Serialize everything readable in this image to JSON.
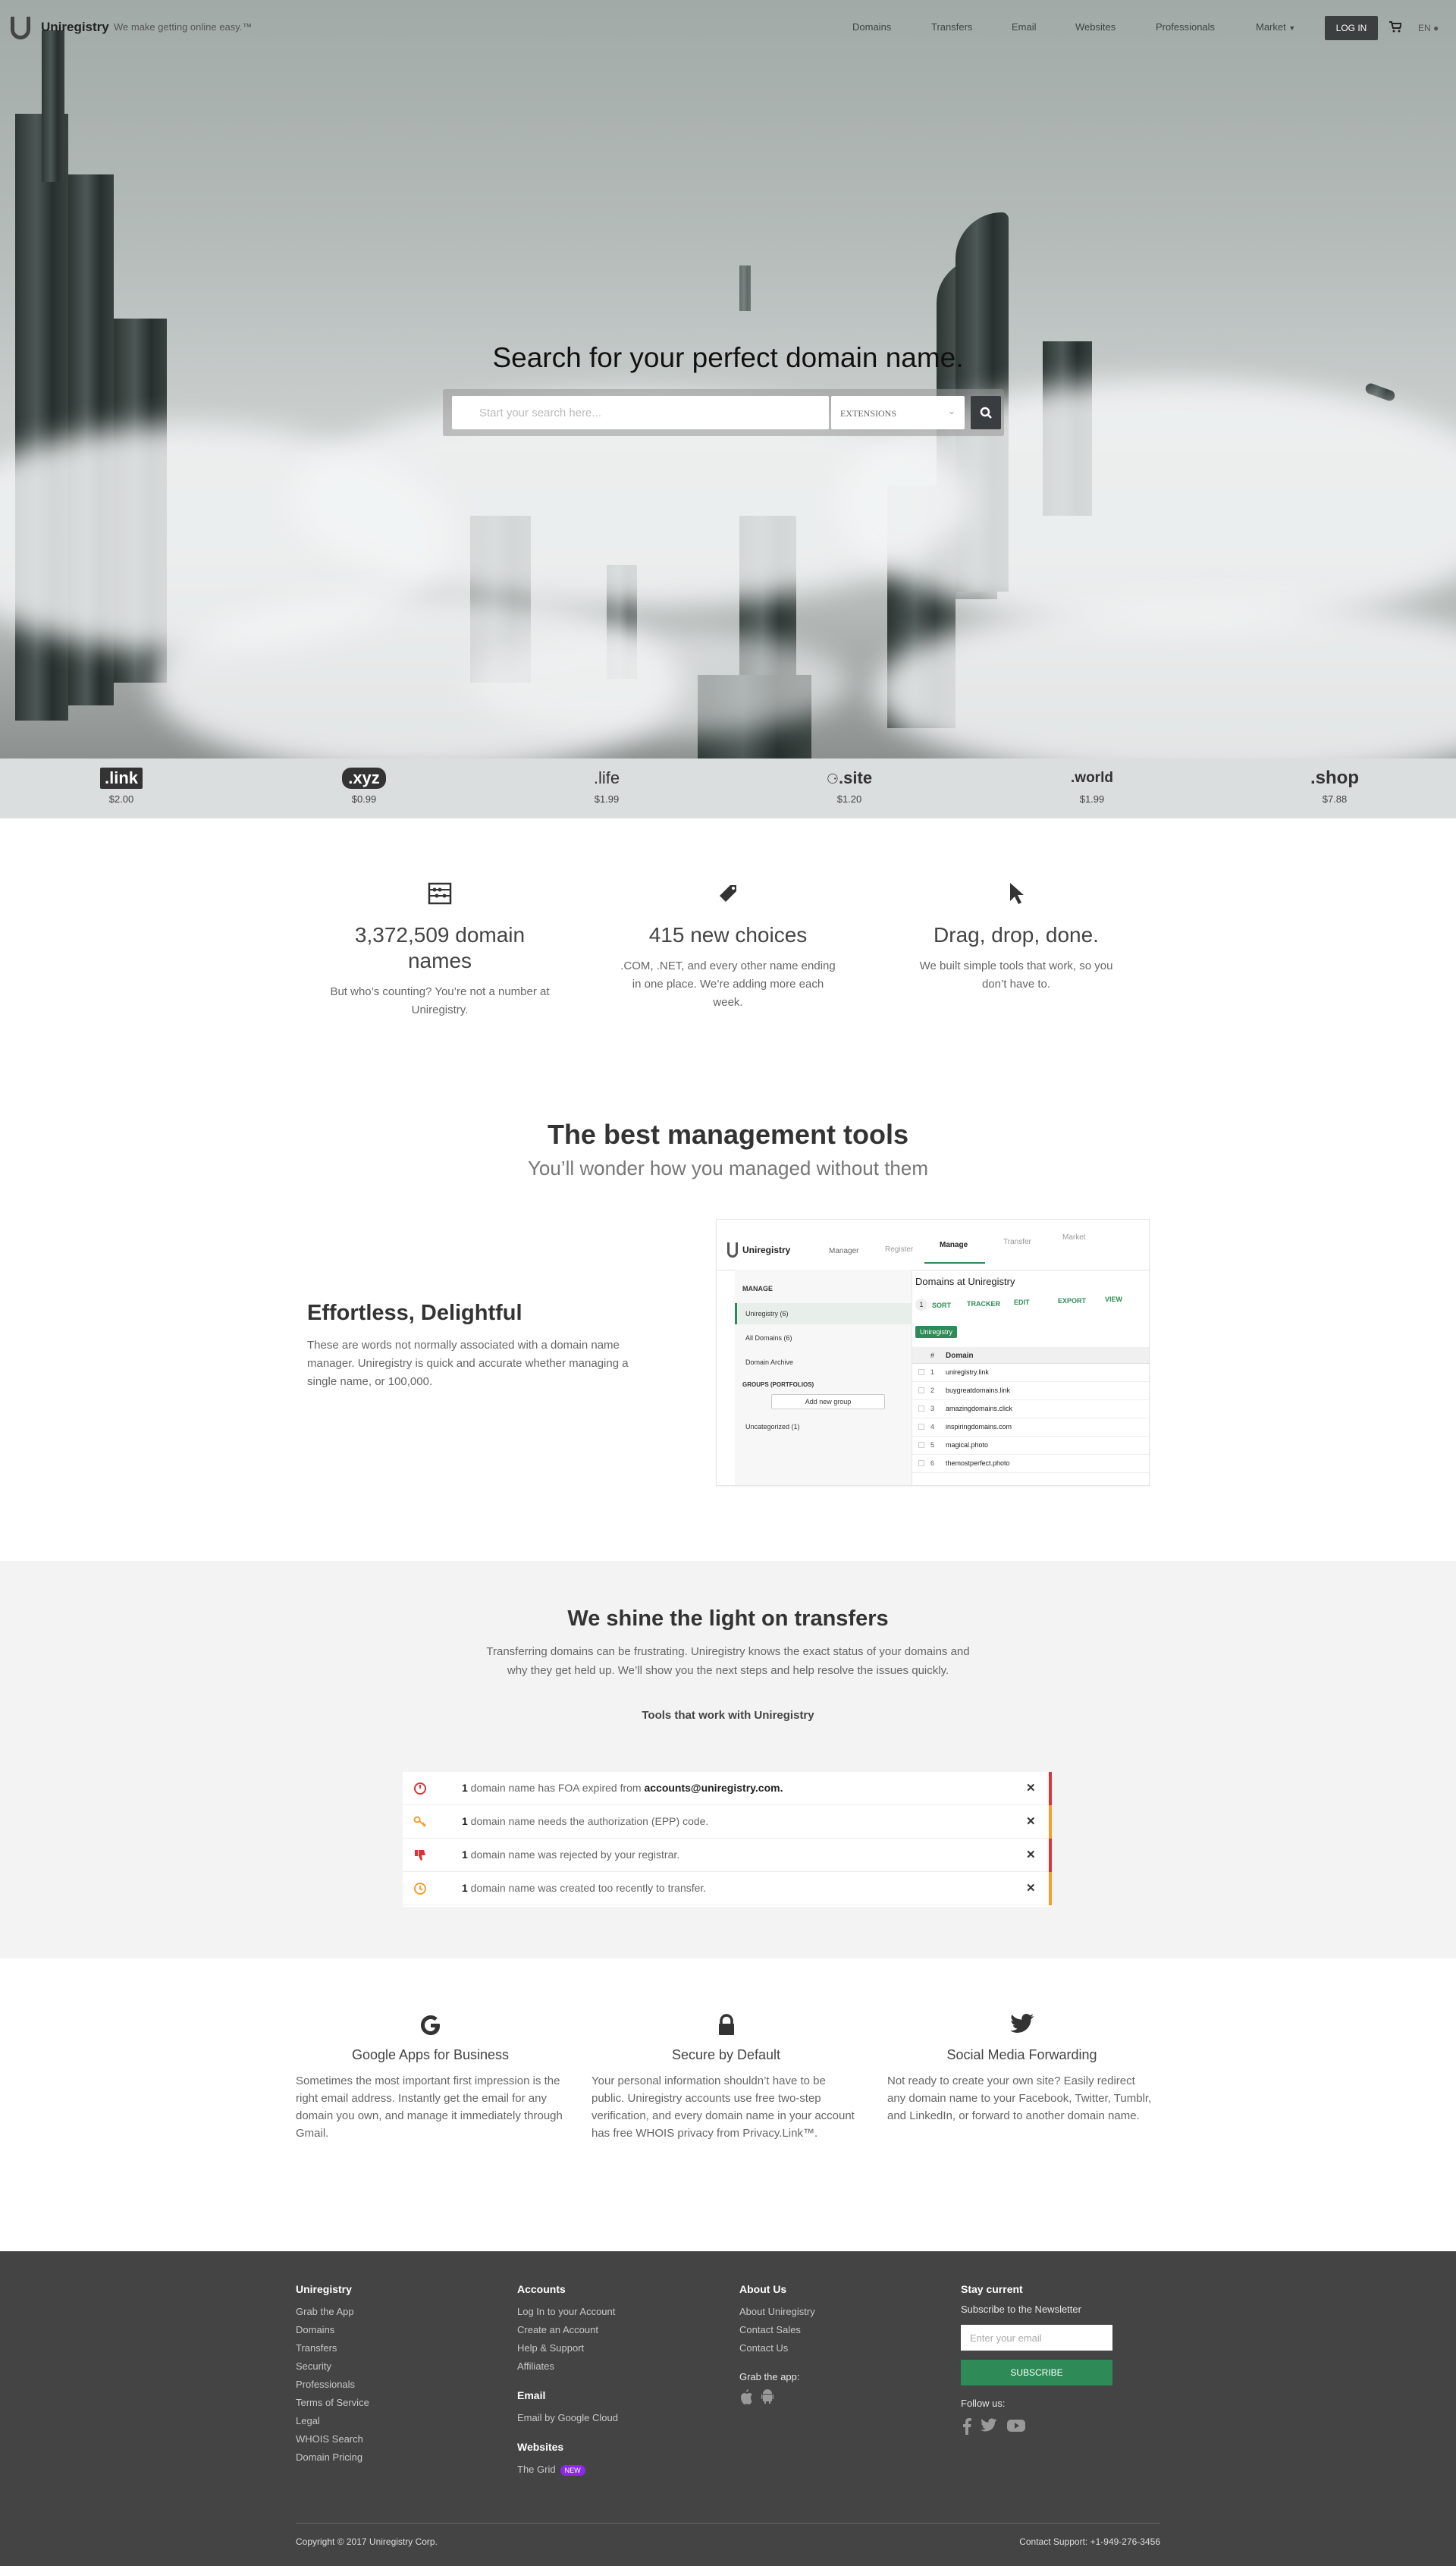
{
  "header": {
    "brand": "Uniregistry",
    "tagline": "We make getting online easy.™",
    "nav": [
      "Domains",
      "Transfers",
      "Email",
      "Websites",
      "Professionals",
      "Market"
    ],
    "login": "LOG IN",
    "lang": "EN"
  },
  "hero": {
    "title": "Search for your perfect domain name.",
    "search_placeholder": "Start your search here...",
    "extensions_label": "EXTENSIONS"
  },
  "tlds": [
    {
      "name": ".link",
      "price": "$2.00"
    },
    {
      "name": ".xyz",
      "price": "$0.99"
    },
    {
      "name": ".life",
      "price": "$1.99"
    },
    {
      "name": ".site",
      "price": "$1.20"
    },
    {
      "name": ".world",
      "price": "$1.99"
    },
    {
      "name": ".shop",
      "price": "$7.88"
    }
  ],
  "features": [
    {
      "title": "3,372,509 domain names",
      "text": "But who’s counting? You’re not a number at Uniregistry."
    },
    {
      "title": "415 new choices",
      "text": ".COM, .NET, and every other name ending in one place. We’re adding more each week."
    },
    {
      "title": "Drag, drop, done.",
      "text": "We built simple tools that work, so you don’t have to."
    }
  ],
  "management": {
    "title": "The best management tools",
    "subtitle": "You’ll wonder how you managed without them",
    "heading": "Effortless, Delightful",
    "text": "These are words not normally associated with a domain name manager.  Uniregistry is quick and accurate whether managing a single name, or 100,000."
  },
  "screenshot": {
    "brand": "Uniregistry",
    "tabs": [
      "Manager",
      "Register",
      "Manage",
      "Transfer",
      "Market"
    ],
    "sidebar_header": "MANAGE",
    "sidebar_items": [
      "Uniregistry (6)",
      "All Domains (6)",
      "Domain Archive"
    ],
    "groups_header": "GROUPS (PORTFOLIOS)",
    "add_group": "Add new group",
    "uncategorized": "Uncategorized (1)",
    "portfolio_title": "Domains at Uniregistry",
    "page_num": "1",
    "toolbar": [
      "SORT",
      "TRACKER",
      "EDIT",
      "EXPORT",
      "VIEW"
    ],
    "filter_tag": "Uniregistry",
    "col_num": "#",
    "col_domain": "Domain",
    "rows": [
      {
        "n": "1",
        "domain": "uniregistry.link"
      },
      {
        "n": "2",
        "domain": "buygreatdomains.link"
      },
      {
        "n": "3",
        "domain": "amazingdomains.click"
      },
      {
        "n": "4",
        "domain": "inspiringdomains.com"
      },
      {
        "n": "5",
        "domain": "magical.photo"
      },
      {
        "n": "6",
        "domain": "themostperfect.photo"
      }
    ]
  },
  "transfers": {
    "title": "We shine the light on transfers",
    "text": "Transferring domains can be frustrating.  Uniregistry knows the exact status of your domains and why they get held up.  We’ll show you the next steps and help resolve the issues quickly.",
    "tools": "Tools that work with Uniregistry",
    "alerts": [
      {
        "count": "1",
        "text": " domain name has FOA expired from ",
        "email": "accounts@uniregistry.com.",
        "color": "#d9343a"
      },
      {
        "count": "1",
        "text": " domain name needs the authorization (EPP) code.",
        "email": "",
        "color": "#f0a030"
      },
      {
        "count": "1",
        "text": " domain name was rejected by your registrar.",
        "email": "",
        "color": "#d9343a"
      },
      {
        "count": "1",
        "text": " domain name was created too recently to transfer.",
        "email": "",
        "color": "#f0a030"
      }
    ]
  },
  "services": [
    {
      "title": "Google Apps for Business",
      "text": "Sometimes the most important first impression is the right email address. Instantly get the email for any domain you own, and manage it immediately through Gmail."
    },
    {
      "title": "Secure by Default",
      "text": "Your personal information shouldn’t have to be public. Uniregistry accounts use free two-step verification, and every domain name in your account has free WHOIS privacy from Privacy.Link™."
    },
    {
      "title": "Social Media Forwarding",
      "text": "Not ready to create your own site? Easily redirect any domain name to your Facebook, Twitter, Tumblr, and LinkedIn, or forward to another domain name."
    }
  ],
  "footer": {
    "col1": {
      "title": "Uniregistry",
      "links": [
        "Grab the App",
        "Domains",
        "Transfers",
        "Security",
        "Professionals",
        "Terms of Service",
        "Legal",
        "WHOIS Search",
        "Domain Pricing"
      ]
    },
    "col2": {
      "title": "Accounts",
      "links": [
        "Log In to your Account",
        "Create an Account",
        "Help & Support",
        "Affiliates"
      ],
      "email_title": "Email",
      "email_links": [
        "Email by Google Cloud"
      ],
      "websites_title": "Websites",
      "websites_link": "The Grid",
      "new_badge": "NEW"
    },
    "col3": {
      "title": "About Us",
      "links": [
        "About Uniregistry",
        "Contact Sales",
        "Contact Us"
      ],
      "app_title": "Grab the app:"
    },
    "col4": {
      "title": "Stay current",
      "newsletter": "Subscribe to the Newsletter",
      "email_placeholder": "Enter your email",
      "subscribe": "SUBSCRIBE",
      "follow": "Follow us:"
    },
    "copyright": "Copyright © 2017 Uniregistry Corp.",
    "support": "Contact Support: +1-949-276-3456"
  }
}
